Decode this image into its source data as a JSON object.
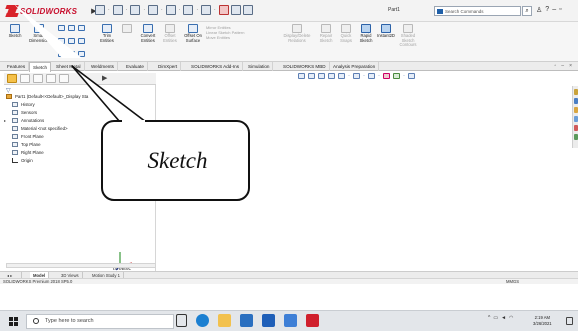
{
  "app": {
    "logo_text": "SOLIDWORKS",
    "doc_title": "Part1",
    "search_placeholder": "Search Commands"
  },
  "ribbon": {
    "sketch": "Sketch",
    "smart_dimension": "Smart Dimension",
    "trim": "Trim Entities",
    "convert": "Convert Entities",
    "offset_entities": "Offset Entities",
    "offset_on_surface": "Offset On Surface",
    "mirror_label": "Mirror Entities",
    "linear_pattern": "Linear Sketch Pattern",
    "move": "Move Entities",
    "display_delete": "Display/Delete Relations",
    "repair": "Repair Sketch",
    "quick_snaps": "Quick Snaps",
    "rapid_sketch": "Rapid Sketch",
    "instant2d": "Instant2D",
    "shaded_contours": "Shaded Sketch Contours"
  },
  "tabs": [
    "Features",
    "Sketch",
    "Sheet Metal",
    "Weldments",
    "Evaluate",
    "DimXpert",
    "SOLIDWORKS Add-Ins",
    "Simulation",
    "SOLIDWORKS MBD",
    "Analysis Preparation"
  ],
  "tree": {
    "part": "Part1 (Default<<Default>_Display Sta",
    "history": "History",
    "sensors": "Sensors",
    "annotations": "Annotations",
    "material": "Material <not specified>",
    "front": "Front Plane",
    "top": "Top Plane",
    "right": "Right Plane",
    "origin": "Origin"
  },
  "view": {
    "trimetric": "*Trimetric"
  },
  "callout": {
    "text": "Sketch"
  },
  "model_tabs": [
    "Model",
    "3D Views",
    "Motion Study 1"
  ],
  "status": {
    "left": "SOLIDWORKS Premium 2018 SP5.0",
    "right": "MMGS"
  },
  "taskbar": {
    "search": "Type here to search",
    "time": "2:19 AM",
    "date": "3/26/2021"
  }
}
